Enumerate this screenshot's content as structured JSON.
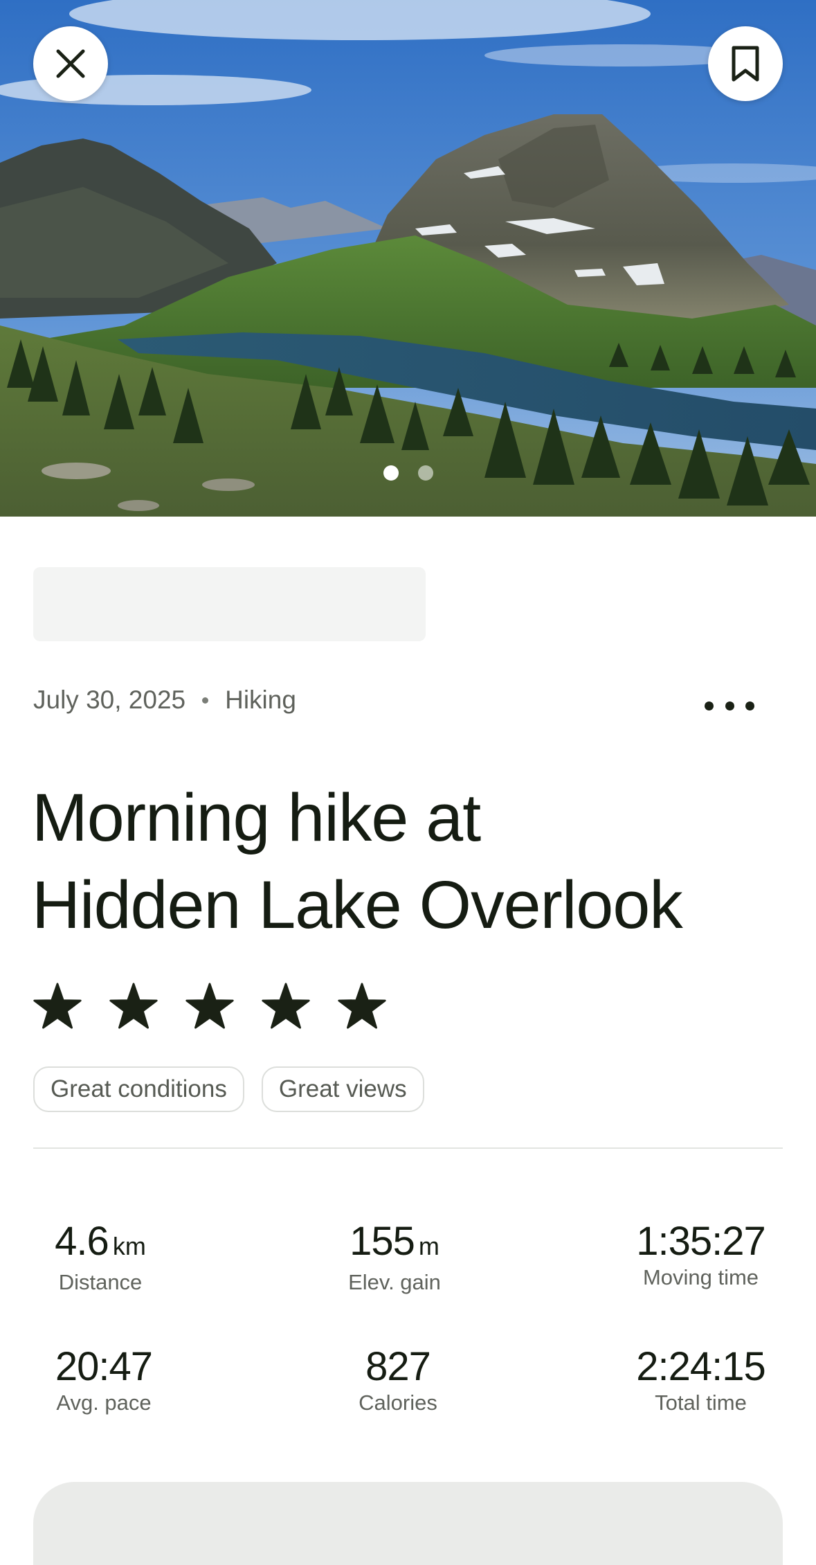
{
  "hero": {
    "close_icon": "close-icon",
    "save_icon": "bookmark-icon",
    "photo_count": 2,
    "active_photo_index": 0
  },
  "activity": {
    "date": "July 30, 2025",
    "sport": "Hiking",
    "more_icon": "more-horizontal-icon",
    "title_line1": "Morning hike at",
    "title_line2": "Hidden Lake Overlook",
    "rating": 5,
    "rating_max": 5,
    "tags": [
      "Great conditions",
      "Great views"
    ]
  },
  "stats": {
    "distance": {
      "value": "4.6",
      "unit": "km",
      "label": "Distance"
    },
    "elev_gain": {
      "value": "155",
      "unit": "m",
      "label": "Elev. gain"
    },
    "moving_time": {
      "value": "1:35:27",
      "label": "Moving time"
    },
    "avg_pace": {
      "value": "20:47",
      "label": "Avg. pace"
    },
    "calories": {
      "value": "827",
      "label": "Calories"
    },
    "total_time": {
      "value": "2:24:15",
      "label": "Total time"
    }
  },
  "colors": {
    "text_primary": "#151c12",
    "text_secondary": "#5f625c",
    "star": "#1a2115",
    "placeholder": "#f3f4f3"
  }
}
